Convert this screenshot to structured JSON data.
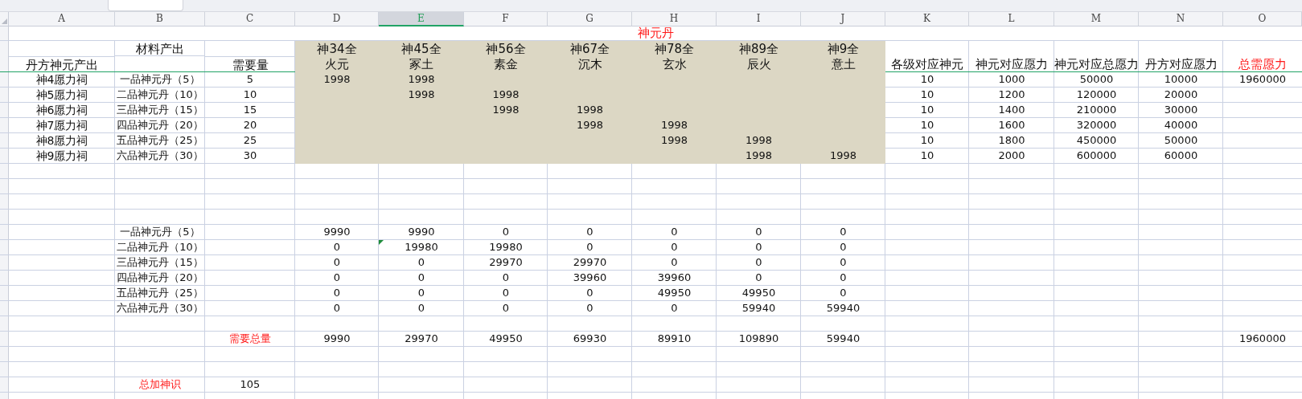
{
  "column_headers": [
    {
      "label": "A",
      "selected": false
    },
    {
      "label": "B",
      "selected": false
    },
    {
      "label": "C",
      "selected": false
    },
    {
      "label": "D",
      "selected": false
    },
    {
      "label": "E",
      "selected": true
    },
    {
      "label": "F",
      "selected": false
    },
    {
      "label": "G",
      "selected": false
    },
    {
      "label": "H",
      "selected": false
    },
    {
      "label": "I",
      "selected": false
    },
    {
      "label": "J",
      "selected": false
    },
    {
      "label": "K",
      "selected": false
    },
    {
      "label": "L",
      "selected": false
    },
    {
      "label": "M",
      "selected": false
    },
    {
      "label": "N",
      "selected": false
    },
    {
      "label": "O",
      "selected": false
    }
  ],
  "rows": [
    {
      "kind": "title",
      "text": "神元丹",
      "emphasis": true
    },
    {
      "kind": "header",
      "shaded": true,
      "cells": {
        "A": {
          "lower": "丹方神元产出"
        },
        "B": {
          "upper": "材料产出"
        },
        "C": {
          "lower": "需要量"
        },
        "D": {
          "upper": "神34全",
          "lower": "火元"
        },
        "E": {
          "upper": "神45全",
          "lower": "冢土"
        },
        "F": {
          "upper": "神56全",
          "lower": "素金"
        },
        "G": {
          "upper": "神67全",
          "lower": "沉木"
        },
        "H": {
          "upper": "神78全",
          "lower": "玄水"
        },
        "I": {
          "upper": "神89全",
          "lower": "辰火"
        },
        "J": {
          "upper": "神9全",
          "lower": "意土"
        },
        "K": {
          "lower": "各级对应神元"
        },
        "L": {
          "lower": "神元对应愿力"
        },
        "M": {
          "lower": "神元对应总愿力"
        },
        "N": {
          "lower": "丹方对应愿力"
        },
        "O": {
          "lower": "总需愿力",
          "emphasis": true
        }
      }
    },
    {
      "kind": "data",
      "shaded": true,
      "cells": {
        "A": "神4愿力祠",
        "B": "一品神元丹（5）",
        "C": "5",
        "D": "1998",
        "E": "1998",
        "K": "10",
        "L": "1000",
        "M": "50000",
        "N": "10000",
        "O": "1960000"
      }
    },
    {
      "kind": "data",
      "shaded": true,
      "cells": {
        "A": "神5愿力祠",
        "B": "二品神元丹（10）",
        "C": "10",
        "E": "1998",
        "F": "1998",
        "K": "10",
        "L": "1200",
        "M": "120000",
        "N": "20000"
      }
    },
    {
      "kind": "data",
      "shaded": true,
      "cells": {
        "A": "神6愿力祠",
        "B": "三品神元丹（15）",
        "C": "15",
        "F": "1998",
        "G": "1998",
        "K": "10",
        "L": "1400",
        "M": "210000",
        "N": "30000"
      }
    },
    {
      "kind": "data",
      "shaded": true,
      "cells": {
        "A": "神7愿力祠",
        "B": "四品神元丹（20）",
        "C": "20",
        "G": "1998",
        "H": "1998",
        "K": "10",
        "L": "1600",
        "M": "320000",
        "N": "40000"
      }
    },
    {
      "kind": "data",
      "shaded": true,
      "cells": {
        "A": "神8愿力祠",
        "B": "五品神元丹（25）",
        "C": "25",
        "H": "1998",
        "I": "1998",
        "K": "10",
        "L": "1800",
        "M": "450000",
        "N": "50000"
      }
    },
    {
      "kind": "data",
      "shaded": true,
      "cells": {
        "A": "神9愿力祠",
        "B": "六品神元丹（30）",
        "C": "30",
        "I": "1998",
        "J": "1998",
        "K": "10",
        "L": "2000",
        "M": "600000",
        "N": "60000"
      }
    },
    {
      "kind": "blank"
    },
    {
      "kind": "blank"
    },
    {
      "kind": "blank"
    },
    {
      "kind": "blank"
    },
    {
      "kind": "data",
      "cells": {
        "B": "一品神元丹（5）",
        "D": "9990",
        "E": "9990",
        "F": "0",
        "G": "0",
        "H": "0",
        "I": "0",
        "J": "0"
      }
    },
    {
      "kind": "data",
      "cells": {
        "B": "二品神元丹（10）",
        "D": "0",
        "E": {
          "text": "19980",
          "warning": true
        },
        "F": "19980",
        "G": "0",
        "H": "0",
        "I": "0",
        "J": "0"
      }
    },
    {
      "kind": "data",
      "cells": {
        "B": "三品神元丹（15）",
        "D": "0",
        "E": "0",
        "F": "29970",
        "G": "29970",
        "H": "0",
        "I": "0",
        "J": "0"
      }
    },
    {
      "kind": "data",
      "cells": {
        "B": "四品神元丹（20）",
        "D": "0",
        "E": "0",
        "F": "0",
        "G": "39960",
        "H": "39960",
        "I": "0",
        "J": "0"
      }
    },
    {
      "kind": "data",
      "cells": {
        "B": "五品神元丹（25）",
        "D": "0",
        "E": "0",
        "F": "0",
        "G": "0",
        "H": "49950",
        "I": "49950",
        "J": "0"
      }
    },
    {
      "kind": "data",
      "cells": {
        "B": "六品神元丹（30）",
        "D": "0",
        "E": "0",
        "F": "0",
        "G": "0",
        "H": "0",
        "I": "59940",
        "J": "59940"
      }
    },
    {
      "kind": "blank"
    },
    {
      "kind": "data",
      "cells": {
        "C": {
          "text": "需要总量",
          "emphasis": true
        },
        "D": "9990",
        "E": "29970",
        "F": "49950",
        "G": "69930",
        "H": "89910",
        "I": "109890",
        "J": "59940",
        "O": "1960000"
      }
    },
    {
      "kind": "blank"
    },
    {
      "kind": "blank"
    },
    {
      "kind": "data",
      "cells": {
        "B": {
          "text": "总加神识",
          "emphasis": true
        },
        "C": "105"
      }
    },
    {
      "kind": "blank"
    }
  ]
}
